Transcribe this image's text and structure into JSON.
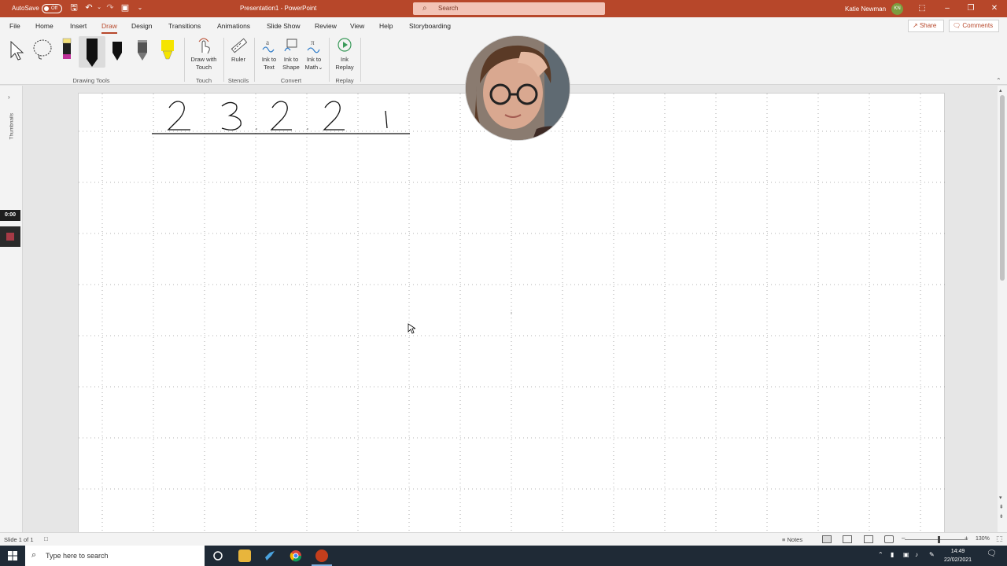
{
  "titlebar": {
    "autosave_label": "AutoSave",
    "autosave_state": "Off",
    "doc_title": "Presentation1  -  PowerPoint",
    "search_placeholder": "Search",
    "user_name": "Katie Newman",
    "user_initials": "KN"
  },
  "menu": {
    "tabs": [
      "File",
      "Home",
      "Insert",
      "Draw",
      "Design",
      "Transitions",
      "Animations",
      "Slide Show",
      "Review",
      "View",
      "Help",
      "Storyboarding"
    ],
    "active_tab": "Draw",
    "share_label": "Share",
    "comments_label": "Comments"
  },
  "ribbon": {
    "groups": {
      "drawing_tools": "Drawing Tools",
      "touch": "Touch",
      "stencils": "Stencils",
      "convert": "Convert",
      "replay": "Replay"
    },
    "buttons": {
      "draw_with_touch_l1": "Draw with",
      "draw_with_touch_l2": "Touch",
      "ruler": "Ruler",
      "ink_to_text_l1": "Ink to",
      "ink_to_text_l2": "Text",
      "ink_to_shape_l1": "Ink to",
      "ink_to_shape_l2": "Shape",
      "ink_to_math_l1": "Ink to",
      "ink_to_math_l2": "Math",
      "ink_replay_l1": "Ink",
      "ink_replay_l2": "Replay"
    },
    "pen_colors": [
      "#f5e27a",
      "#111111",
      "#111111",
      "#333333",
      "#f5e400"
    ]
  },
  "left_pane": {
    "label": "Thumbnails",
    "timer": "0:00"
  },
  "slide": {
    "handwritten_digits": [
      "2",
      "3",
      "2",
      "2",
      "1"
    ]
  },
  "status": {
    "slide_count": "Slide 1 of 1",
    "notes_label": "Notes",
    "zoom": "130%"
  },
  "taskbar": {
    "search_placeholder": "Type here to search",
    "time": "14:49",
    "date": "22/02/2021"
  },
  "colors": {
    "accent": "#b7472a",
    "taskbar": "#1f2a36"
  }
}
